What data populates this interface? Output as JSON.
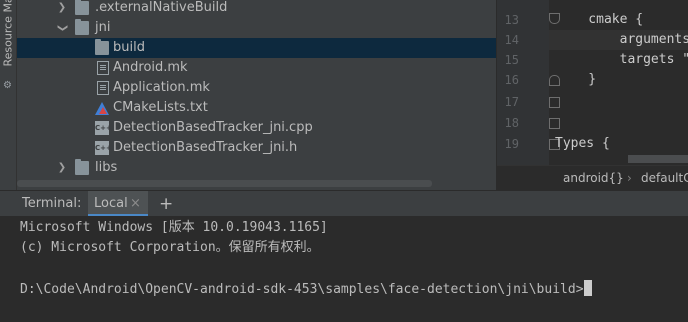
{
  "sidebar": {
    "label": "Resource Manager"
  },
  "tree": [
    {
      "label": ".externalNativeBuild",
      "type": "folder",
      "arrow": "collapsed"
    },
    {
      "label": "jni",
      "type": "folder",
      "arrow": "expanded"
    },
    {
      "label": "build",
      "type": "folder",
      "arrow": "",
      "selected": true
    },
    {
      "label": "Android.mk",
      "type": "file"
    },
    {
      "label": "Application.mk",
      "type": "file"
    },
    {
      "label": "CMakeLists.txt",
      "type": "cmake"
    },
    {
      "label": "DetectionBasedTracker_jni.cpp",
      "type": "cpp"
    },
    {
      "label": "DetectionBasedTracker_jni.h",
      "type": "cpp-h"
    },
    {
      "label": "libs",
      "type": "folder",
      "arrow": "collapsed"
    }
  ],
  "editor": {
    "lines": [
      {
        "num": "13",
        "code": "    cmake {"
      },
      {
        "num": "14",
        "code": "        arguments"
      },
      {
        "num": "15",
        "code": "        targets \"d"
      },
      {
        "num": "16",
        "code": "    }"
      },
      {
        "num": "17",
        "code": ""
      },
      {
        "num": "18",
        "code": ""
      },
      {
        "num": "19",
        "code": "Types {"
      }
    ],
    "breadcrumb": [
      "android{}",
      "defaultC"
    ]
  },
  "terminal": {
    "title": "Terminal:",
    "tab": "Local",
    "tab_close": "×",
    "add": "+",
    "lines": [
      "Microsoft Windows [版本 10.0.19043.1165]",
      "(c) Microsoft Corporation。保留所有权利。",
      "",
      "D:\\Code\\Android\\OpenCV-android-sdk-453\\samples\\face-detection\\jni\\build>"
    ]
  }
}
